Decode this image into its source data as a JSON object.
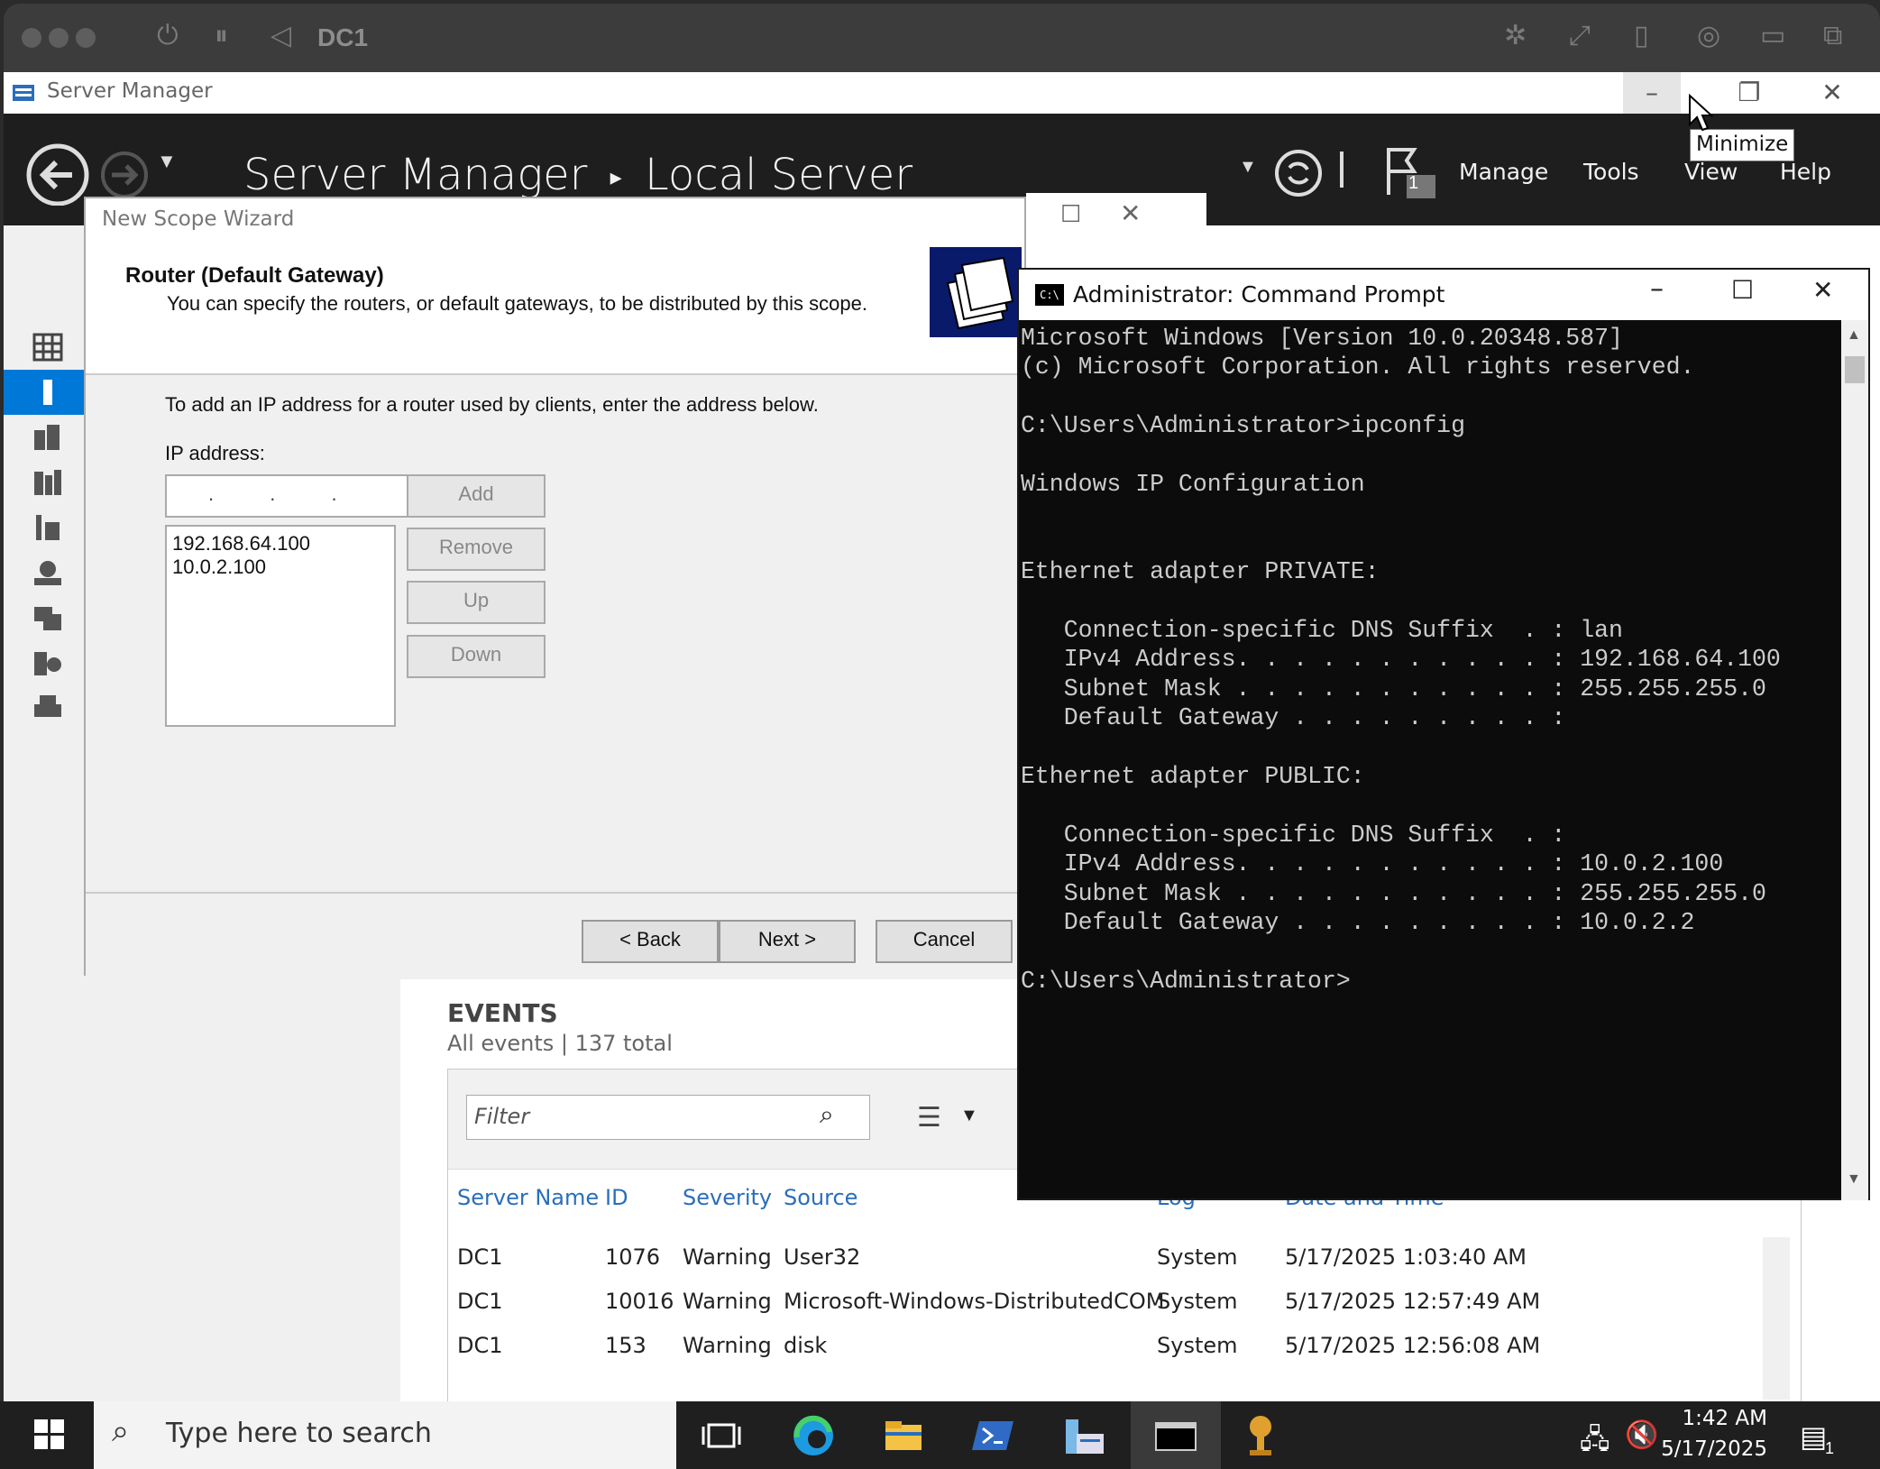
{
  "host": {
    "title": "DC1"
  },
  "server_manager": {
    "window_title": "Server Manager",
    "breadcrumb": {
      "root": "Server Manager",
      "page": "Local Server"
    },
    "menu": [
      "Manage",
      "Tools",
      "View",
      "Help"
    ],
    "flag_count": "1",
    "tooltip": "Minimize"
  },
  "wizard": {
    "title": "New Scope Wizard",
    "heading": "Router (Default Gateway)",
    "subheading": "You can specify the routers, or default gateways, to be distributed by this scope.",
    "instruction": "To add an IP address for a router used by clients, enter the address below.",
    "ip_label": "IP address:",
    "ip_placeholder": ". . .",
    "routers": [
      "192.168.64.100",
      "10.0.2.100"
    ],
    "buttons": {
      "add": "Add",
      "remove": "Remove",
      "up": "Up",
      "down": "Down"
    },
    "footer": {
      "back": "< Back",
      "next": "Next >",
      "cancel": "Cancel"
    }
  },
  "cmd": {
    "title": "Administrator: Command Prompt",
    "lines": [
      "Microsoft Windows [Version 10.0.20348.587]",
      "(c) Microsoft Corporation. All rights reserved.",
      "",
      "C:\\Users\\Administrator>ipconfig",
      "",
      "Windows IP Configuration",
      "",
      "",
      "Ethernet adapter PRIVATE:",
      "",
      "   Connection-specific DNS Suffix  . : lan",
      "   IPv4 Address. . . . . . . . . . . : 192.168.64.100",
      "   Subnet Mask . . . . . . . . . . . : 255.255.255.0",
      "   Default Gateway . . . . . . . . . :",
      "",
      "Ethernet adapter PUBLIC:",
      "",
      "   Connection-specific DNS Suffix  . :",
      "   IPv4 Address. . . . . . . . . . . : 10.0.2.100",
      "   Subnet Mask . . . . . . . . . . . : 255.255.255.0",
      "   Default Gateway . . . . . . . . . : 10.0.2.2",
      "",
      "C:\\Users\\Administrator>"
    ]
  },
  "events": {
    "title": "EVENTS",
    "subtitle": "All events | 137 total",
    "filter_placeholder": "Filter",
    "columns": [
      "Server Name",
      "ID",
      "Severity",
      "Source",
      "Log",
      "Date and Time"
    ],
    "rows": [
      [
        "DC1",
        "1076",
        "Warning",
        "User32",
        "System",
        "5/17/2025 1:03:40 AM"
      ],
      [
        "DC1",
        "10016",
        "Warning",
        "Microsoft-Windows-DistributedCOM",
        "System",
        "5/17/2025 12:57:49 AM"
      ],
      [
        "DC1",
        "153",
        "Warning",
        "disk",
        "System",
        "5/17/2025 12:56:08 AM"
      ]
    ]
  },
  "taskbar": {
    "search_placeholder": "Type here to search",
    "time": "1:42 AM",
    "date": "5/17/2025",
    "notification_count": "1"
  },
  "colors": {
    "accent": "#0078d7",
    "header": "#1e1e1e",
    "link": "#2a6ebb",
    "cmd_bg": "#0c0c0c"
  }
}
